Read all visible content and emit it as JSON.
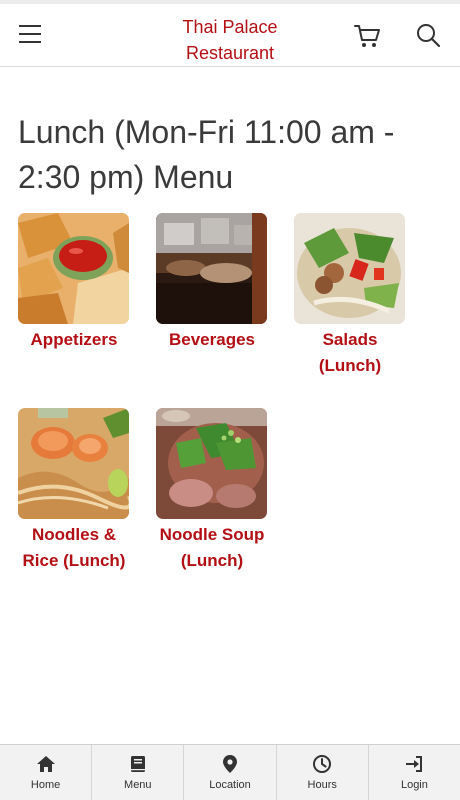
{
  "header": {
    "brand_line1": "Thai Palace",
    "brand_line2": "Restaurant",
    "menu_icon": "hamburger-icon",
    "cart_icon": "cart-icon",
    "search_icon": "search-icon"
  },
  "page": {
    "title": "Lunch (Mon-Fri 11:00 am - 2:30 pm) Menu"
  },
  "categories": [
    {
      "label": "Appetizers",
      "image": "appetizers-photo"
    },
    {
      "label": "Beverages",
      "image": "beverages-photo"
    },
    {
      "label": "Salads (Lunch)",
      "image": "salads-photo"
    },
    {
      "label": "Noodles & Rice (Lunch)",
      "image": "noodles-rice-photo"
    },
    {
      "label": "Noodle Soup (Lunch)",
      "image": "noodle-soup-photo"
    }
  ],
  "bottom_nav": [
    {
      "label": "Home",
      "icon": "home-icon"
    },
    {
      "label": "Menu",
      "icon": "book-icon"
    },
    {
      "label": "Location",
      "icon": "map-pin-icon"
    },
    {
      "label": "Hours",
      "icon": "clock-icon"
    },
    {
      "label": "Login",
      "icon": "login-icon"
    }
  ],
  "colors": {
    "accent": "#b40f14",
    "nav_background": "#f2f2f2",
    "title_text": "#3a3a3a"
  }
}
